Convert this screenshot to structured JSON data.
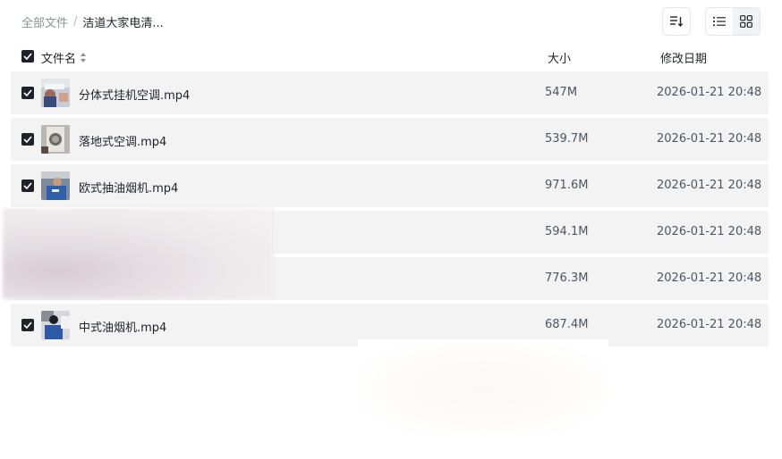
{
  "breadcrumb": {
    "root": "全部文件",
    "separator": "/",
    "current": "洁道大家电清..."
  },
  "toolbar": {
    "sort_icon": "sort-lines-icon",
    "list_view_icon": "list-view-icon",
    "grid_view_icon": "grid-view-icon",
    "active_view": "list"
  },
  "table": {
    "columns": {
      "name": "文件名",
      "size": "大小",
      "date": "修改日期"
    },
    "rows": [
      {
        "name": "分体式挂机空调.mp4",
        "size": "547M",
        "date": "2026-01-21 20:48",
        "checked": true
      },
      {
        "name": "落地式空调.mp4",
        "size": "539.7M",
        "date": "2026-01-21 20:48",
        "checked": true
      },
      {
        "name": "欧式抽油烟机.mp4",
        "size": "971.6M",
        "date": "2026-01-21 20:48",
        "checked": true
      },
      {
        "name": "",
        "size": "594.1M",
        "date": "2026-01-21 20:48",
        "checked": true
      },
      {
        "name": "",
        "size": "776.3M",
        "date": "2026-01-21 20:48",
        "checked": true
      },
      {
        "name": "中式油烟机.mp4",
        "size": "687.4M",
        "date": "2026-01-21 20:48",
        "checked": true
      }
    ]
  },
  "colors": {
    "row_bg": "#f3f3f4",
    "checkbox": "#1f2329",
    "muted_text": "#8a8f99"
  }
}
